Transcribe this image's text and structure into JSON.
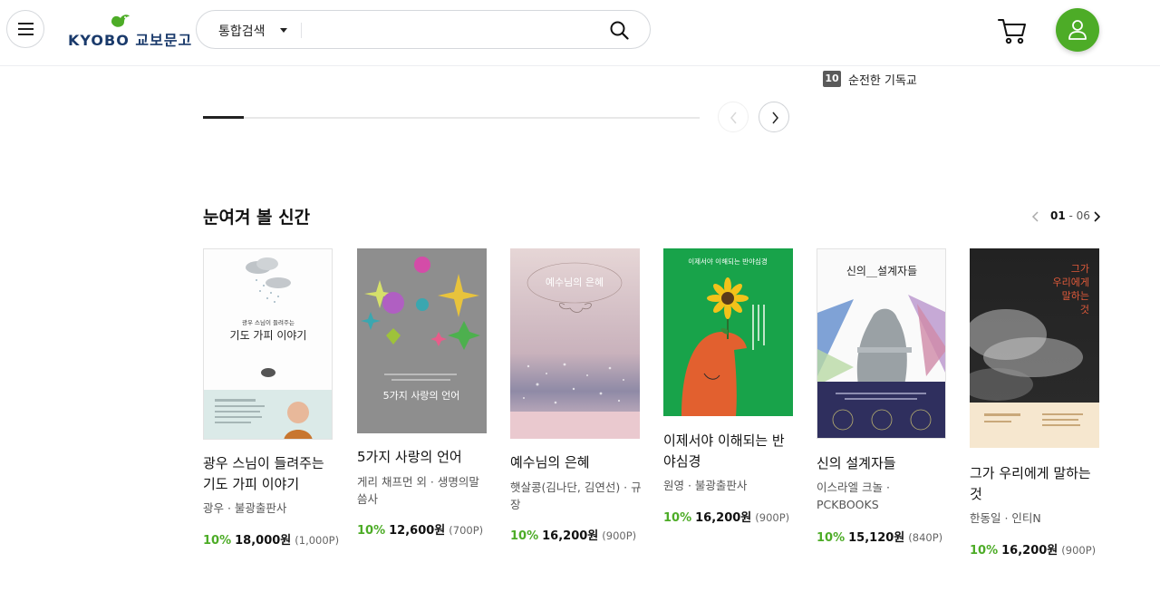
{
  "header": {
    "logo_text": "KYOBO 교보문고",
    "search_category": "통합검색",
    "search_value": ""
  },
  "ranking": {
    "rank": "10",
    "title": "순전한 기독교"
  },
  "carousel": {
    "progress_fraction": 0.083
  },
  "section": {
    "title": "눈여겨 볼 신간",
    "pager_current": "01",
    "pager_sep": " - ",
    "pager_total": "06"
  },
  "books": [
    {
      "title": "광우 스님이 들려주는 기도 가피 이야기",
      "author": "광우 · 불광출판사",
      "discount": "10%",
      "price": "18,000원",
      "point": "(1,000P)",
      "cover_text": [
        "광우 스님이 들려주는",
        "기도 가피 이야기"
      ]
    },
    {
      "title": "5가지 사랑의 언어",
      "author": "게리 채프먼 외 · 생명의말씀사",
      "discount": "10%",
      "price": "12,600원",
      "point": "(700P)",
      "cover_text": [
        "5가지 사랑의 언어"
      ]
    },
    {
      "title": "예수님의 은혜",
      "author": "햇살콩(김나단, 김연선) · 규장",
      "discount": "10%",
      "price": "16,200원",
      "point": "(900P)",
      "cover_text": [
        "예수님의 은혜"
      ]
    },
    {
      "title": "이제서야 이해되는 반야심경",
      "author": "원영 · 불광출판사",
      "discount": "10%",
      "price": "16,200원",
      "point": "(900P)",
      "cover_text": [
        "이제서야 이해되는 반야심경"
      ]
    },
    {
      "title": "신의 설계자들",
      "author": "이스라엘 크놀 · PCKBOOKS",
      "discount": "10%",
      "price": "15,120원",
      "point": "(840P)",
      "cover_text": [
        "신의__설계자들"
      ]
    },
    {
      "title": "그가 우리에게 말하는 것",
      "author": "한동일 · 인티N",
      "discount": "10%",
      "price": "16,200원",
      "point": "(900P)",
      "cover_text": [
        "그가",
        "우리에게",
        "말하는",
        "것"
      ]
    }
  ],
  "colors": {
    "accent_green": "#4dac27",
    "brand_navy": "#1a3a6b"
  },
  "icons": {
    "menu": "hamburger-icon",
    "search": "search-icon",
    "cart": "cart-icon",
    "user": "user-icon",
    "prev": "chevron-left-icon",
    "next": "chevron-right-icon"
  }
}
